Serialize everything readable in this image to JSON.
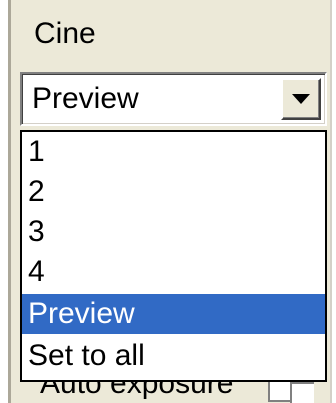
{
  "group": {
    "title": "Cine"
  },
  "combo": {
    "selected_value": "Preview",
    "button_icon": "chevron-down-icon"
  },
  "dropdown": {
    "items": [
      "1",
      "2",
      "3",
      "4",
      "Preview",
      "Set to all"
    ],
    "selected_index": 4
  },
  "behind": {
    "label": "Auto exposure"
  },
  "colors": {
    "panel_background": "#ece9d8",
    "selection_background": "#316ac5",
    "selection_text": "#ffffff",
    "text": "#000000"
  }
}
